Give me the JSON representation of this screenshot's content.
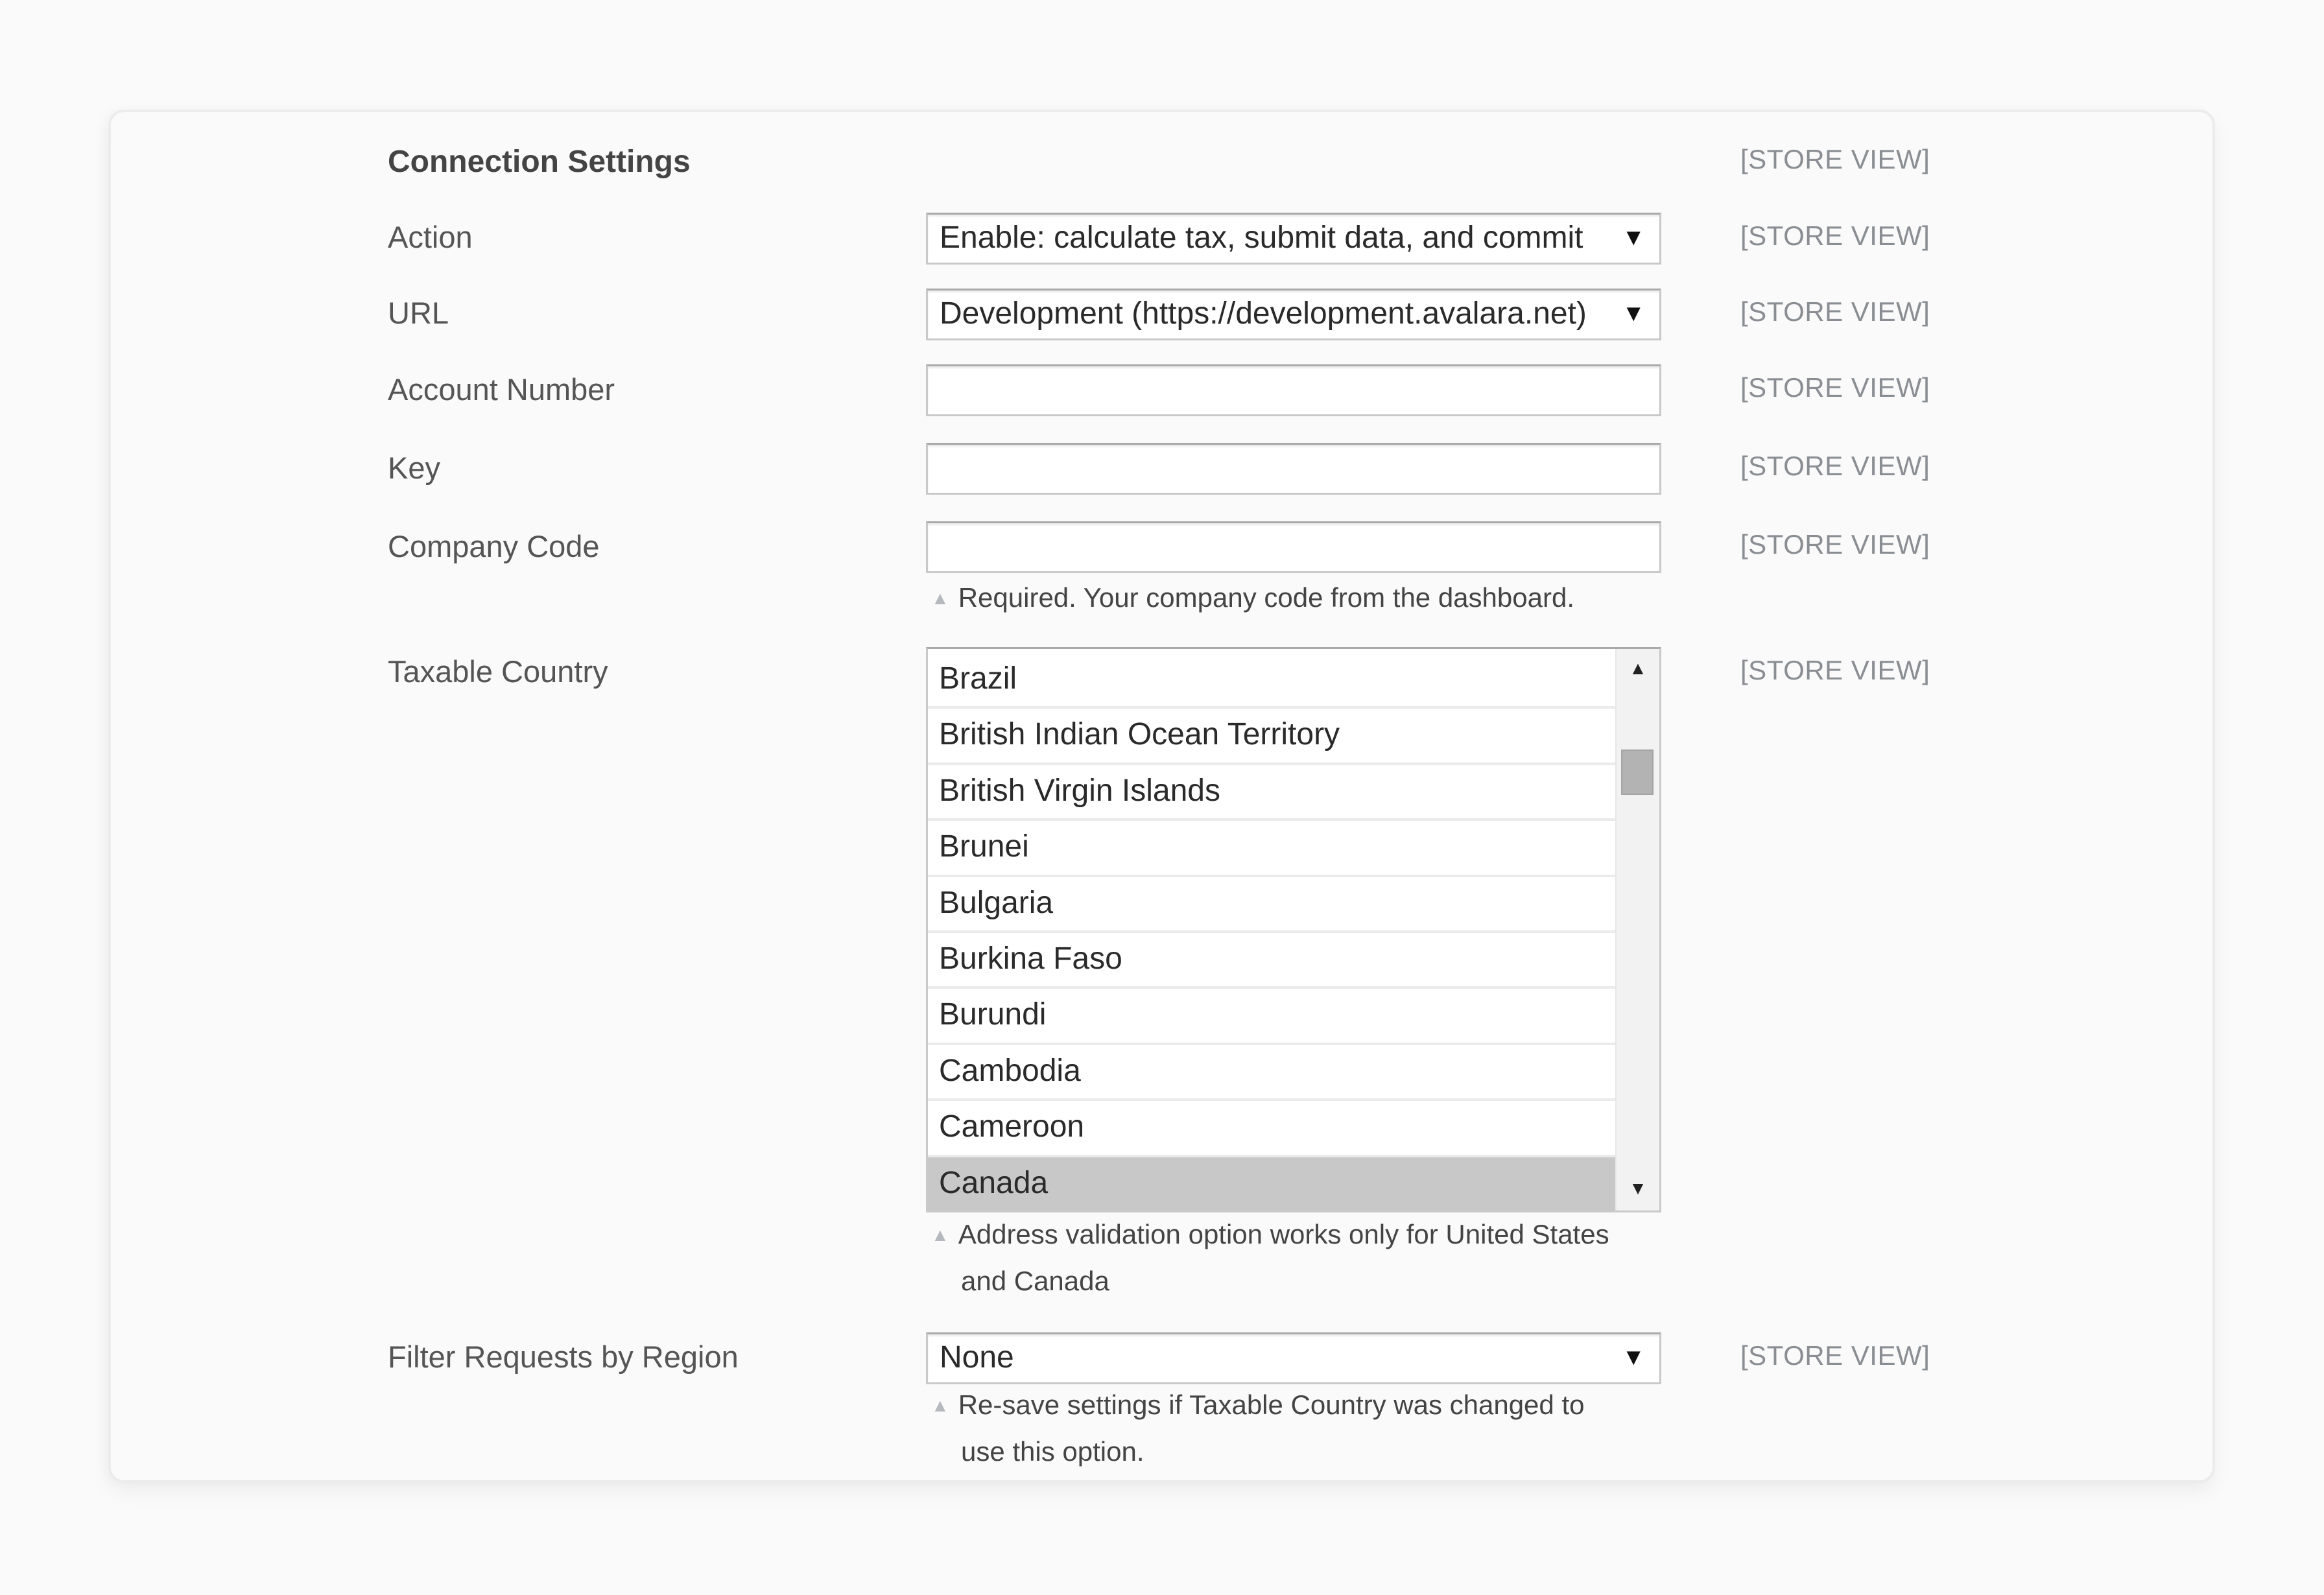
{
  "section": {
    "title": "Connection Settings",
    "scope_label": "[STORE VIEW]"
  },
  "fields": {
    "action": {
      "label": "Action",
      "value": "Enable: calculate tax, submit data, and commit",
      "scope": "[STORE VIEW]"
    },
    "url": {
      "label": "URL",
      "value": "Development (https://development.avalara.net)",
      "scope": "[STORE VIEW]"
    },
    "account_number": {
      "label": "Account Number",
      "value": "",
      "scope": "[STORE VIEW]"
    },
    "key": {
      "label": "Key",
      "value": "",
      "scope": "[STORE VIEW]"
    },
    "company_code": {
      "label": "Company Code",
      "value": "",
      "scope": "[STORE VIEW]",
      "note": "Required. Your company code from the dashboard."
    },
    "taxable_country": {
      "label": "Taxable Country",
      "scope": "[STORE VIEW]",
      "options": [
        "Brazil",
        "British Indian Ocean Territory",
        "British Virgin Islands",
        "Brunei",
        "Bulgaria",
        "Burkina Faso",
        "Burundi",
        "Cambodia",
        "Cameroon",
        "Canada"
      ],
      "selected": "Canada",
      "note_line1": "Address validation option works only for United States",
      "note_line2": "and Canada"
    },
    "filter_region": {
      "label": "Filter Requests by Region",
      "value": "None",
      "scope": "[STORE VIEW]",
      "note_line1": "Re-save settings if Taxable Country was changed to",
      "note_line2": "use this option."
    }
  },
  "icons": {
    "dropdown": "▼",
    "scroll_up": "▲",
    "scroll_down": "▼",
    "note": "▲"
  },
  "colors": {
    "background": "#fafafa",
    "selected_option": "#c8c8c8",
    "scope_text": "#8a8e93"
  }
}
